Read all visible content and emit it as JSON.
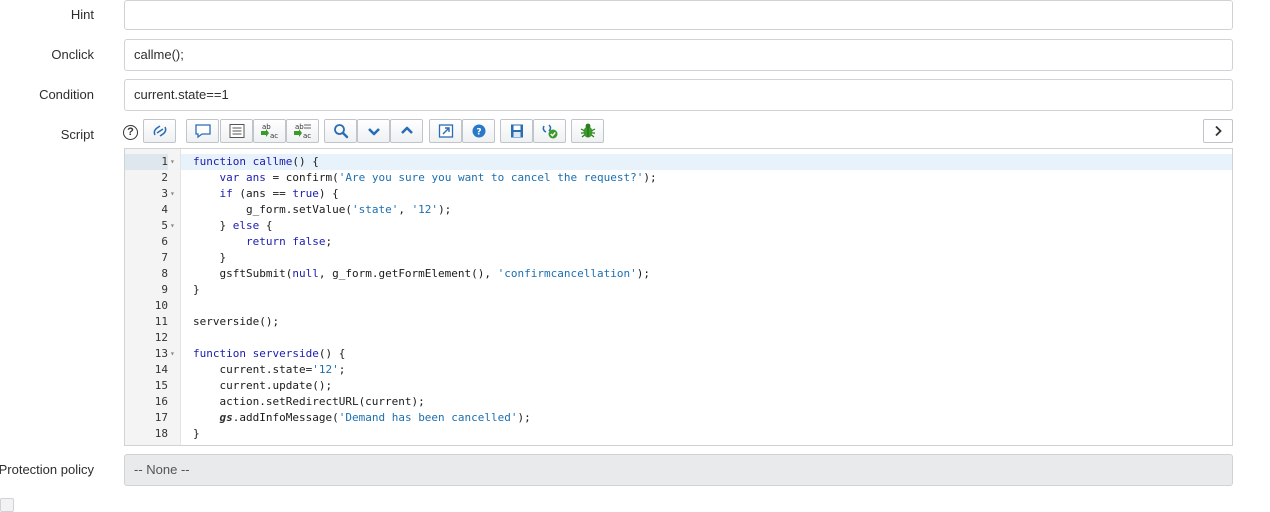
{
  "form": {
    "hint": {
      "label": "Hint",
      "value": ""
    },
    "onclick": {
      "label": "Onclick",
      "value": "callme();"
    },
    "condition": {
      "label": "Condition",
      "value": "current.state==1"
    },
    "script": {
      "label": "Script",
      "help_glyph": "?"
    },
    "protection_policy": {
      "label": "Protection policy",
      "value": "-- None --"
    }
  },
  "toolbar": {
    "buttons": [
      {
        "name": "toggle-syntax-icon"
      },
      {
        "name": "comment-icon"
      },
      {
        "name": "format-code-icon"
      },
      {
        "name": "replace-icon"
      },
      {
        "name": "replace-all-icon"
      },
      {
        "name": "search-icon"
      },
      {
        "name": "find-next-icon"
      },
      {
        "name": "find-previous-icon"
      },
      {
        "name": "fullscreen-icon"
      },
      {
        "name": "help-icon"
      },
      {
        "name": "save-icon"
      },
      {
        "name": "script-check-icon"
      },
      {
        "name": "debug-icon"
      }
    ],
    "expand_icon": "chevron-right-icon"
  },
  "editor": {
    "lines": [
      {
        "n": "1",
        "fold": true,
        "text": "function callme() {"
      },
      {
        "n": "2",
        "fold": false,
        "text": "    var ans = confirm('Are you sure you want to cancel the request?');"
      },
      {
        "n": "3",
        "fold": true,
        "text": "    if (ans == true) {"
      },
      {
        "n": "4",
        "fold": false,
        "text": "        g_form.setValue('state', '12');"
      },
      {
        "n": "5",
        "fold": true,
        "text": "    } else {"
      },
      {
        "n": "6",
        "fold": false,
        "text": "        return false;"
      },
      {
        "n": "7",
        "fold": false,
        "text": "    }"
      },
      {
        "n": "8",
        "fold": false,
        "text": "    gsftSubmit(null, g_form.getFormElement(), 'confirmcancellation');"
      },
      {
        "n": "9",
        "fold": false,
        "text": "}"
      },
      {
        "n": "10",
        "fold": false,
        "text": ""
      },
      {
        "n": "11",
        "fold": false,
        "text": "serverside();"
      },
      {
        "n": "12",
        "fold": false,
        "text": ""
      },
      {
        "n": "13",
        "fold": true,
        "text": "function serverside() {"
      },
      {
        "n": "14",
        "fold": false,
        "text": "    current.state='12';"
      },
      {
        "n": "15",
        "fold": false,
        "text": "    current.update();"
      },
      {
        "n": "16",
        "fold": false,
        "text": "    action.setRedirectURL(current);"
      },
      {
        "n": "17",
        "fold": false,
        "text": "    gs.addInfoMessage('Demand has been cancelled');"
      },
      {
        "n": "18",
        "fold": false,
        "text": "}"
      }
    ]
  },
  "colors": {
    "keyword": "#1c1cb0",
    "string": "#1c6fb0",
    "active_line": "#e8f2fb",
    "readonly_bg": "#e8eaeb"
  }
}
